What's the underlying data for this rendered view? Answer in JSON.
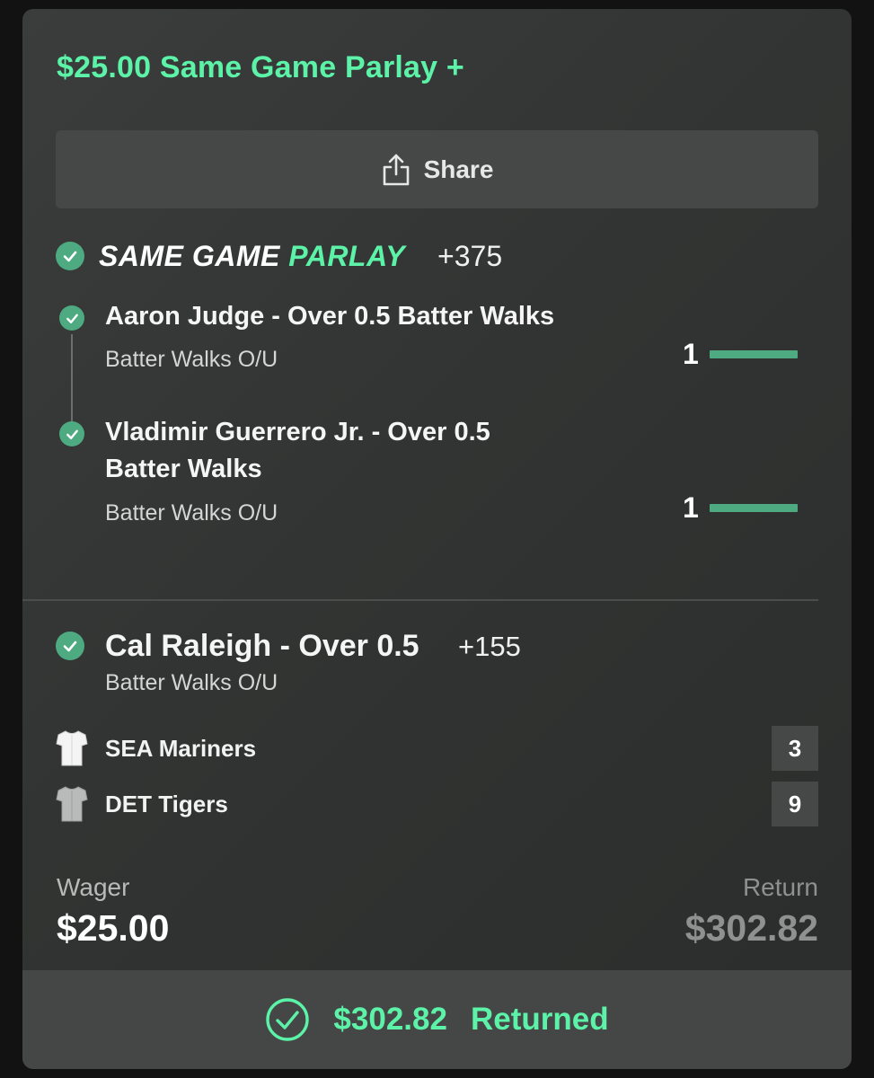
{
  "bet": {
    "title": "$25.00 Same Game Parlay +",
    "share_label": "Share",
    "sgp": {
      "label_prefix": "SAME GAME",
      "label_accent": "PARLAY",
      "odds": "+375",
      "legs": [
        {
          "title": "Aaron Judge - Over 0.5 Batter Walks",
          "market": "Batter Walks O/U",
          "result": "1"
        },
        {
          "title_line1": "Vladimir Guerrero Jr. - Over 0.5",
          "title_line2": "Batter Walks",
          "market": "Batter Walks O/U",
          "result": "1"
        }
      ]
    },
    "single": {
      "title": "Cal Raleigh - Over 0.5",
      "odds": "+155",
      "market": "Batter Walks O/U"
    },
    "teams": [
      {
        "name": "SEA Mariners",
        "score": "3",
        "icon": "white-jersey-icon"
      },
      {
        "name": "DET Tigers",
        "score": "9",
        "icon": "gray-jersey-icon"
      }
    ],
    "wager_label": "Wager",
    "wager_value": "$25.00",
    "return_label": "Return",
    "return_value": "$302.82",
    "footer": {
      "amount": "$302.82",
      "status": "Returned"
    }
  },
  "colors": {
    "accent": "#5cf3a8",
    "check": "#4eab81",
    "card": "#333534",
    "muted": "#8e9190"
  }
}
